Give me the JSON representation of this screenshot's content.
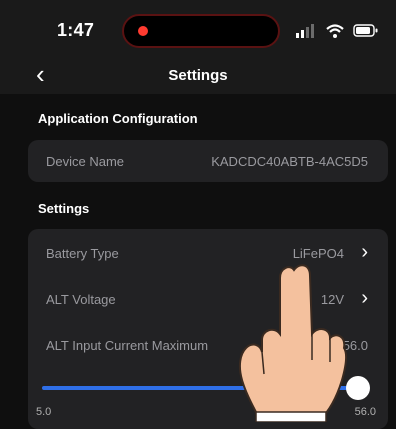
{
  "status_bar": {
    "time": "1:47",
    "icons": [
      "signal-icon",
      "wifi-icon",
      "battery-icon"
    ],
    "recording_color": "#ff3b30"
  },
  "nav": {
    "back_icon": "chevron-left-icon",
    "title": "Settings"
  },
  "app_config": {
    "header": "Application Configuration",
    "device_name_label": "Device Name",
    "device_name_value": "KADCDC40ABTB-4AC5D5"
  },
  "settings": {
    "header": "Settings",
    "battery_type_label": "Battery Type",
    "battery_type_value": "LiFePO4",
    "alt_voltage_label": "ALT Voltage",
    "alt_voltage_value": "12V",
    "alt_input_label": "ALT Input Current Maximum",
    "alt_input_value": "56.0",
    "slider_min": "5.0",
    "slider_max": "56.0",
    "slider_fraction": 1.0
  },
  "colors": {
    "accent": "#2f6fe8",
    "card": "#222224",
    "background": "#0f0f0f"
  }
}
